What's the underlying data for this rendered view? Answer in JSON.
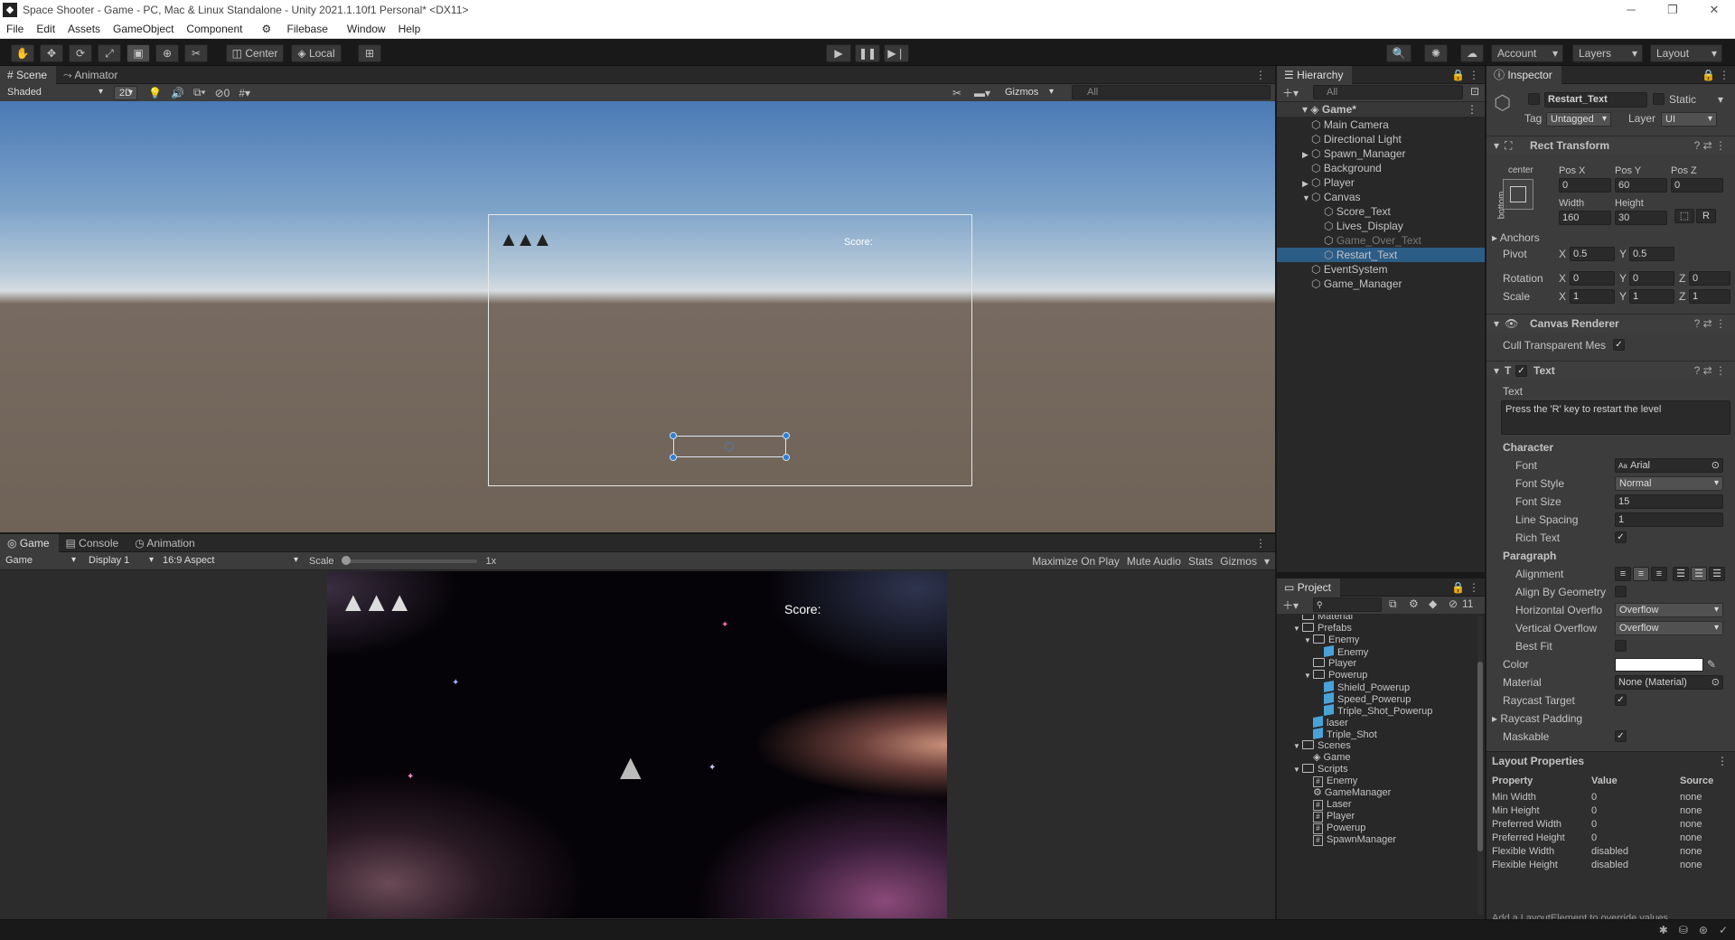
{
  "window": {
    "title": "Space Shooter - Game - PC, Mac & Linux Standalone - Unity 2021.1.10f1 Personal* <DX11>",
    "minimize": "─",
    "maximize": "❐",
    "close": "✕"
  },
  "menu": [
    "File",
    "Edit",
    "Assets",
    "GameObject",
    "Component",
    "Filebase",
    "Window",
    "Help"
  ],
  "toolbar": {
    "center": "Center",
    "local": "Local",
    "account": "Account",
    "layers": "Layers",
    "layout": "Layout"
  },
  "scene": {
    "tabs": [
      "Scene",
      "Animator"
    ],
    "shading": "Shaded",
    "mode2d": "2D",
    "hidden_count": "0",
    "gizmos": "Gizmos",
    "search_placeholder": "All",
    "score_label": "Score:"
  },
  "game": {
    "tabs": [
      "Game",
      "Console",
      "Animation"
    ],
    "view": "Game",
    "display": "Display 1",
    "aspect": "16:9 Aspect",
    "scale_label": "Scale",
    "scale_value": "1x",
    "scale_fraction": 0.0,
    "toggles": [
      "Maximize On Play",
      "Mute Audio",
      "Stats",
      "Gizmos"
    ],
    "score_label": "Score:"
  },
  "hierarchy": {
    "title": "Hierarchy",
    "search_placeholder": "All",
    "root": "Game*",
    "items": [
      {
        "label": "Main Camera",
        "depth": 1,
        "expander": ""
      },
      {
        "label": "Directional Light",
        "depth": 1,
        "expander": ""
      },
      {
        "label": "Spawn_Manager",
        "depth": 1,
        "expander": "▶"
      },
      {
        "label": "Background",
        "depth": 1,
        "expander": ""
      },
      {
        "label": "Player",
        "depth": 1,
        "expander": "▶"
      },
      {
        "label": "Canvas",
        "depth": 1,
        "expander": "▼"
      },
      {
        "label": "Score_Text",
        "depth": 2,
        "expander": ""
      },
      {
        "label": "Lives_Display",
        "depth": 2,
        "expander": ""
      },
      {
        "label": "Game_Over_Text",
        "depth": 2,
        "expander": "",
        "inactive": true
      },
      {
        "label": "Restart_Text",
        "depth": 2,
        "expander": "",
        "selected": true
      },
      {
        "label": "EventSystem",
        "depth": 1,
        "expander": ""
      },
      {
        "label": "Game_Manager",
        "depth": 1,
        "expander": ""
      }
    ]
  },
  "project": {
    "title": "Project",
    "hidden_count": "11",
    "items": [
      {
        "label": "Material",
        "depth": 1,
        "kind": "folder",
        "expander": ""
      },
      {
        "label": "Prefabs",
        "depth": 1,
        "kind": "folder",
        "expander": "▼"
      },
      {
        "label": "Enemy",
        "depth": 2,
        "kind": "folder",
        "expander": "▼"
      },
      {
        "label": "Enemy",
        "depth": 3,
        "kind": "prefab",
        "expander": ""
      },
      {
        "label": "Player",
        "depth": 2,
        "kind": "folder",
        "expander": ""
      },
      {
        "label": "Powerup",
        "depth": 2,
        "kind": "folder",
        "expander": "▼"
      },
      {
        "label": "Shield_Powerup",
        "depth": 3,
        "kind": "prefab",
        "expander": ""
      },
      {
        "label": "Speed_Powerup",
        "depth": 3,
        "kind": "prefab",
        "expander": ""
      },
      {
        "label": "Triple_Shot_Powerup",
        "depth": 3,
        "kind": "prefab",
        "expander": ""
      },
      {
        "label": "laser",
        "depth": 2,
        "kind": "prefab",
        "expander": ""
      },
      {
        "label": "Triple_Shot",
        "depth": 2,
        "kind": "prefab",
        "expander": ""
      },
      {
        "label": "Scenes",
        "depth": 1,
        "kind": "folder",
        "expander": "▼"
      },
      {
        "label": "Game",
        "depth": 2,
        "kind": "scene",
        "expander": ""
      },
      {
        "label": "Scripts",
        "depth": 1,
        "kind": "folder",
        "expander": "▼"
      },
      {
        "label": "Enemy",
        "depth": 2,
        "kind": "script",
        "expander": ""
      },
      {
        "label": "GameManager",
        "depth": 2,
        "kind": "gear",
        "expander": ""
      },
      {
        "label": "Laser",
        "depth": 2,
        "kind": "script",
        "expander": ""
      },
      {
        "label": "Player",
        "depth": 2,
        "kind": "script",
        "expander": ""
      },
      {
        "label": "Powerup",
        "depth": 2,
        "kind": "script",
        "expander": ""
      },
      {
        "label": "SpawnManager",
        "depth": 2,
        "kind": "script",
        "expander": ""
      }
    ]
  },
  "inspector": {
    "title": "Inspector",
    "object_name": "Restart_Text",
    "static_label": "Static",
    "tag_label": "Tag",
    "tag_value": "Untagged",
    "layer_label": "Layer",
    "layer_value": "UI",
    "rect_transform": {
      "title": "Rect Transform",
      "anchor_h": "center",
      "anchor_v": "bottom",
      "posx_label": "Pos X",
      "posy_label": "Pos Y",
      "posz_label": "Pos Z",
      "posx": "0",
      "posy": "60",
      "posz": "0",
      "width_label": "Width",
      "height_label": "Height",
      "width": "160",
      "height": "30",
      "r_button": "R",
      "anchors": "Anchors",
      "pivot_label": "Pivot",
      "pivot_x": "0.5",
      "pivot_y": "0.5",
      "rotation_label": "Rotation",
      "rot_x": "0",
      "rot_y": "0",
      "rot_z": "0",
      "scale_label": "Scale",
      "scale_x": "1",
      "scale_y": "1",
      "scale_z": "1",
      "x": "X",
      "y": "Y",
      "z": "Z"
    },
    "canvas_renderer": {
      "title": "Canvas Renderer",
      "cull_label": "Cull Transparent Mes"
    },
    "text": {
      "title": "Text",
      "text_label": "Text",
      "text_value": "Press the 'R' key to restart the level",
      "character": "Character",
      "font_label": "Font",
      "font_value": "Arial",
      "font_style_label": "Font Style",
      "font_style_value": "Normal",
      "font_size_label": "Font Size",
      "font_size_value": "15",
      "line_spacing_label": "Line Spacing",
      "line_spacing_value": "1",
      "rich_text_label": "Rich Text",
      "paragraph": "Paragraph",
      "alignment_label": "Alignment",
      "align_geom_label": "Align By Geometry",
      "hover_label": "Horizontal Overflo",
      "hover_value": "Overflow",
      "vover_label": "Vertical Overflow",
      "vover_value": "Overflow",
      "best_fit_label": "Best Fit",
      "color_label": "Color",
      "color_value": "#ffffff",
      "material_label": "Material",
      "material_value": "None (Material)",
      "raycast_label": "Raycast Target",
      "raycast_padding_label": "Raycast Padding",
      "maskable_label": "Maskable"
    },
    "layout_properties": {
      "title": "Layout Properties",
      "headers": [
        "Property",
        "Value",
        "Source"
      ],
      "rows": [
        [
          "Min Width",
          "0",
          "none"
        ],
        [
          "Min Height",
          "0",
          "none"
        ],
        [
          "Preferred Width",
          "0",
          "none"
        ],
        [
          "Preferred Height",
          "0",
          "none"
        ],
        [
          "Flexible Width",
          "disabled",
          "none"
        ],
        [
          "Flexible Height",
          "disabled",
          "none"
        ]
      ],
      "footer": "Add a LayoutElement to override values"
    }
  }
}
